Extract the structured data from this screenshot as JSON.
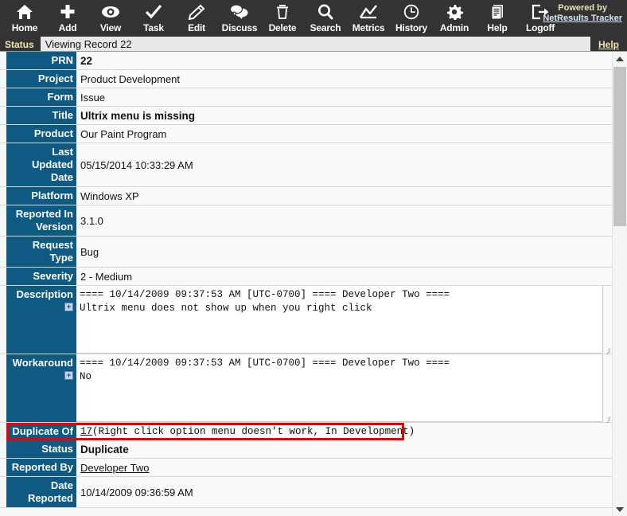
{
  "toolbar": {
    "items": [
      {
        "label": "Home",
        "icon": "home-icon"
      },
      {
        "label": "Add",
        "icon": "plus-icon"
      },
      {
        "label": "View",
        "icon": "eye-icon"
      },
      {
        "label": "Task",
        "icon": "check-icon"
      },
      {
        "label": "Edit",
        "icon": "pencil-icon"
      },
      {
        "label": "Discuss",
        "icon": "chat-bubbles-icon"
      },
      {
        "label": "Delete",
        "icon": "trash-icon"
      },
      {
        "label": "Search",
        "icon": "magnifier-icon"
      },
      {
        "label": "Metrics",
        "icon": "chart-line-icon"
      },
      {
        "label": "History",
        "icon": "clock-icon"
      },
      {
        "label": "Admin",
        "icon": "gear-icon"
      },
      {
        "label": "Help",
        "icon": "document-icon"
      },
      {
        "label": "Logoff",
        "icon": "logout-arrow-icon"
      }
    ],
    "powered_by": "Powered by",
    "brand": "NetResults Tracker",
    "background_color": "#333333",
    "brand_color": "#d8e8f8"
  },
  "statusbar": {
    "label": "Status",
    "message": "Viewing Record 22",
    "help_label": "Help"
  },
  "record": {
    "highlight_color": "#ee0000",
    "label_bg_color": "#0e5a82",
    "fields": [
      {
        "label": "PRN",
        "value": "22",
        "style": "bold"
      },
      {
        "label": "Project",
        "value": "Product Development",
        "style": "plain"
      },
      {
        "label": "Form",
        "value": "Issue",
        "style": "plain"
      },
      {
        "label": "Title",
        "value": "Ultrix menu is missing",
        "style": "bold"
      },
      {
        "label": "Product",
        "value": "Our Paint Program",
        "style": "plain"
      },
      {
        "label": "Last Updated Date",
        "value": "05/15/2014 10:33:29 AM",
        "style": "plain"
      },
      {
        "label": "Platform",
        "value": "Windows XP",
        "style": "plain"
      },
      {
        "label": "Reported In Version",
        "value": "3.1.0",
        "style": "plain"
      },
      {
        "label": "Request Type",
        "value": "Bug",
        "style": "plain"
      },
      {
        "label": "Severity",
        "value": "2 - Medium",
        "style": "plain"
      }
    ],
    "description": {
      "label": "Description",
      "expand_label": "+",
      "text": "==== 10/14/2009 09:37:53 AM [UTC-0700] ==== Developer Two ====\nUltrix menu does not show up when you right click"
    },
    "workaround": {
      "label": "Workaround",
      "expand_label": "+",
      "text": "==== 10/14/2009 09:37:53 AM [UTC-0700] ==== Developer Two ====\nNo"
    },
    "duplicate_of": {
      "label": "Duplicate Of",
      "link": "17",
      "detail": " (Right click option menu doesn't work, In Development)"
    },
    "status_field": {
      "label": "Status",
      "value": "Duplicate"
    },
    "reported_by": {
      "label": "Reported By",
      "value": "Developer Two"
    },
    "date_reported": {
      "label": "Date Reported",
      "value": "10/14/2009 09:36:59 AM"
    }
  }
}
